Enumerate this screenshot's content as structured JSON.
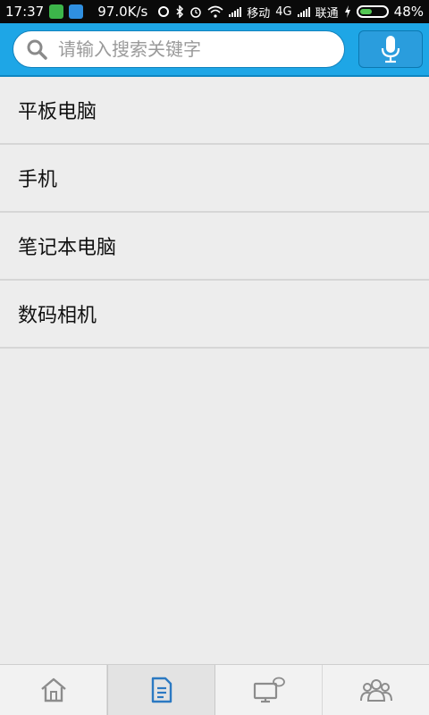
{
  "status_bar": {
    "time": "17:37",
    "net_speed": "97.0K/s",
    "carrier1": "移动",
    "network_type": "4G",
    "carrier2": "联通",
    "battery": "48%",
    "battery_level": 0.48
  },
  "header": {
    "search_placeholder": "请输入搜索关键字",
    "accent_color": "#1ea6e6"
  },
  "list": {
    "items": [
      {
        "label": "平板电脑"
      },
      {
        "label": "手机"
      },
      {
        "label": "笔记本电脑"
      },
      {
        "label": "数码相机"
      }
    ]
  },
  "bottom_nav": {
    "tabs": [
      {
        "icon": "home-icon",
        "active": false
      },
      {
        "icon": "document-icon",
        "active": true
      },
      {
        "icon": "tv-chat-icon",
        "active": false
      },
      {
        "icon": "community-icon",
        "active": false
      }
    ]
  }
}
